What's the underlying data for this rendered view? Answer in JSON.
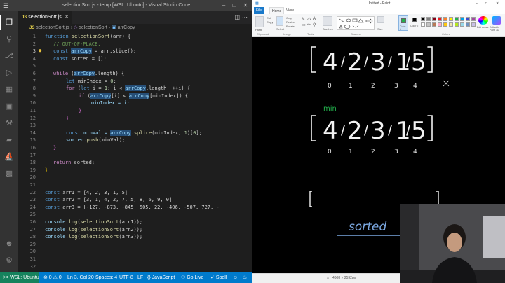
{
  "vscode": {
    "window_title": "selectionSort.js - temp [WSL: Ubuntu] - Visual Studio Code",
    "tab": {
      "name": "selectionSort.js",
      "badge": "JS"
    },
    "breadcrumb": {
      "file": "selectionSort.js",
      "func": "selectionSort",
      "var": "arrCopy"
    },
    "lines": [
      "1",
      "2",
      "3",
      "4",
      "5",
      "6",
      "7",
      "8",
      "9",
      "10",
      "11",
      "12",
      "13",
      "14",
      "15",
      "16",
      "17",
      "18",
      "19",
      "20",
      "21",
      "22",
      "23",
      "24",
      "25",
      "26",
      "27",
      "28",
      "29",
      "30",
      "31",
      "32",
      "33"
    ],
    "code": {
      "l1_kw": "function",
      "l1_fn": "selectionSort",
      "l1_rest": "(arr) {",
      "l2": "// OUT-OF-PLACE.",
      "l3_kw": "const",
      "l3_var": "arrCopy",
      "l3_rest": " = arr.slice();",
      "l4_kw": "const",
      "l4_rest": " sorted = [];",
      "l6_kw": "while",
      "l6_var": "arrCopy",
      "l6_rest": ".length) {",
      "l7_kw": "let",
      "l7_rest": " minIndex = ",
      "l7_num": "0",
      "l7_end": ";",
      "l8_kw": "for",
      "l8_a": " (",
      "l8_let": "let",
      "l8_b": " i = ",
      "l8_n1": "1",
      "l8_c": "; i < ",
      "l8_var": "arrCopy",
      "l8_d": ".length; ++i) {",
      "l9_kw": "if",
      "l9_a": " (",
      "l9_var1": "arrCopy",
      "l9_b": "[i] < ",
      "l9_var2": "arrCopy",
      "l9_c": "[minIndex]) {",
      "l10": "minIndex = i;",
      "l11": "}",
      "l12": "}",
      "l14_kw": "const",
      "l14_a": " minVal = ",
      "l14_var": "arrCopy",
      "l14_b": ".",
      "l14_fn": "splice",
      "l14_c": "(minIndex, ",
      "l14_n1": "1",
      "l14_d": ")[",
      "l14_n2": "0",
      "l14_e": "];",
      "l15_a": "sorted.",
      "l15_fn": "push",
      "l15_b": "(minVal);",
      "l16": "}",
      "l18_kw": "return",
      "l18_rest": " sorted;",
      "l19": "}",
      "l22_kw": "const",
      "l22_rest": " arr1 = [4, 2, 3, 1, 5]",
      "l23_kw": "const",
      "l23_rest": " arr2 = [3, 1, 4, 2, 7, 5, 8, 6, 9, 0]",
      "l24_kw": "const",
      "l24_rest": " arr3 = [-127, -873, -845, 505, 22, -406, -507, 727, -",
      "l26_a": "console.",
      "l26_fn": "log",
      "l26_b": "(",
      "l26_fn2": "selectionSort",
      "l26_c": "(arr1));",
      "l27_a": "console.",
      "l27_fn": "log",
      "l27_b": "(",
      "l27_fn2": "selectionSort",
      "l27_c": "(arr2));",
      "l28_a": "console.",
      "l28_fn": "log",
      "l28_b": "(",
      "l28_fn2": "selectionSort",
      "l28_c": "(arr3));"
    },
    "status": {
      "remote": "WSL: Ubuntu",
      "problems": "⊗ 0 ⚠ 0",
      "position": "Ln 3, Col 20",
      "spaces": "Spaces: 4",
      "encoding": "UTF-8",
      "eol": "LF",
      "language": "{} JavaScript",
      "golive": "Go Live",
      "spell": "Spell"
    }
  },
  "paint": {
    "window_title": "Untitled - Paint",
    "tabs": {
      "file": "File",
      "home": "Home",
      "view": "View"
    },
    "groups": {
      "clipboard": "Clipboard",
      "image": "Image",
      "tools": "Tools",
      "shapes": "Shapes",
      "colors": "Colors"
    },
    "buttons": {
      "paste": "Paste",
      "select": "Select",
      "brushes": "Brushes",
      "size": "Size",
      "color1": "Color 1",
      "color2": "Color 2",
      "edit_colors": "Edit colors",
      "edit_paint3d": "Edit with Paint 3D"
    },
    "ribbon_small": {
      "cut": "Cut",
      "copy": "Copy",
      "crop": "Crop",
      "resize": "Resize",
      "rotate": "Rotate"
    },
    "status_size": "4608 × 2592px",
    "palette": [
      "#000000",
      "#7f7f7f",
      "#880015",
      "#ed1c24",
      "#ff7f27",
      "#fff200",
      "#22b14c",
      "#00a2e8",
      "#3f48cc",
      "#a349a4",
      "#ffffff",
      "#c3c3c3",
      "#b97a57",
      "#ffaec9",
      "#ffc90e",
      "#efe4b0",
      "#b5e61d",
      "#99d9ea",
      "#7092be",
      "#c8bfe7"
    ],
    "drawing": {
      "row1_digits": [
        "4",
        "2",
        "3",
        "1",
        "5"
      ],
      "row1_indices": [
        "0",
        "1",
        "2",
        "3",
        "4"
      ],
      "min_label": "min",
      "row2_digits": [
        "4",
        "2",
        "3",
        "1",
        "5"
      ],
      "row2_indices": [
        "0",
        "1",
        "2",
        "3",
        "4"
      ],
      "sorted_label": "sorted"
    }
  }
}
